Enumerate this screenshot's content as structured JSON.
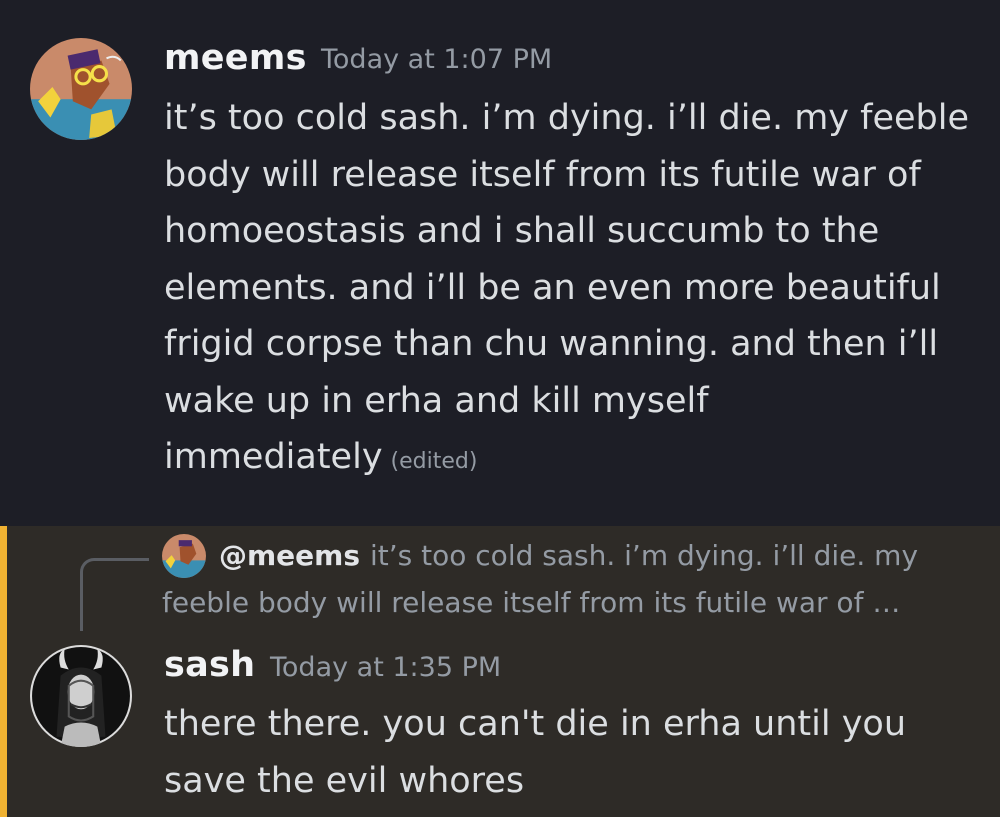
{
  "messages": [
    {
      "username": "meems",
      "timestamp": "Today at 1:07 PM",
      "content": "it’s too cold sash. i’m dying. i’ll die. my feeble body will release itself from its futile war of homoeostasis and i shall succumb to the elements. and i’ll be an even more beautiful frigid corpse than chu wanning. and then i’ll wake up in erha and kill myself immediately",
      "edited_label": "(edited)",
      "avatar_icon": "cartoon-avatar-icon"
    },
    {
      "username": "sash",
      "timestamp": "Today at 1:35 PM",
      "content": "there there. you can't die in erha until you save the evil whores",
      "avatar_icon": "horned-woman-avatar-icon",
      "reply": {
        "mention": "@meems",
        "preview": "it’s too cold sash. i’m dying. i’ll die. my feeble body will release itself from its futile war of …"
      }
    }
  ],
  "colors": {
    "background": "#1d1e26",
    "mention_background": "#2e2b27",
    "mention_bar": "#f0b232",
    "username": "#f2f3f5",
    "timestamp": "#949ba4",
    "text": "#dbdee1"
  }
}
